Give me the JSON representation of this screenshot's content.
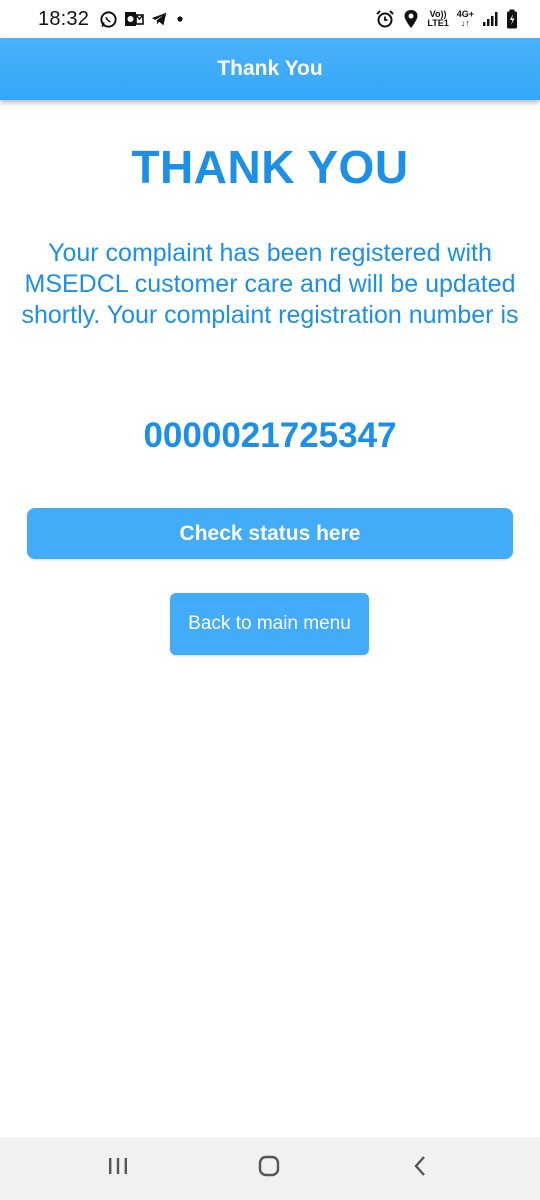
{
  "status_bar": {
    "time": "18:32",
    "notification_icons": [
      "whatsapp-icon",
      "outlook-icon",
      "telegram-icon",
      "dot-icon"
    ],
    "right_icons": [
      "alarm-icon",
      "location-icon",
      "volte-icon",
      "4g-icon",
      "signal-icon",
      "battery-icon"
    ],
    "volte_label_top": "Vo))",
    "volte_label_bottom": "LTE1",
    "network_label": "4G+"
  },
  "app_bar": {
    "title": "Thank You"
  },
  "main": {
    "heading": "THANK YOU",
    "message": "Your complaint has been registered with MSEDCL customer care and will be updated shortly. Your complaint registration number is",
    "registration_number": "0000021725347",
    "check_status_label": "Check status here",
    "back_label": "Back to main menu"
  },
  "nav_bar": {
    "icons": [
      "recents-icon",
      "home-icon",
      "back-icon"
    ]
  },
  "colors": {
    "accent": "#42acf8",
    "heading_text": "#1c8fe6",
    "app_bar": "#3aa9f8"
  }
}
